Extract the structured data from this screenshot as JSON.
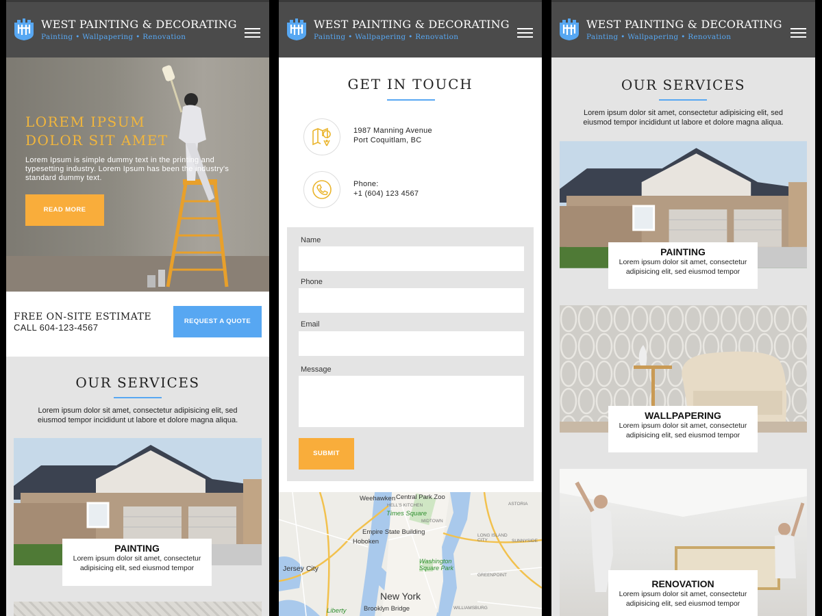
{
  "brand": {
    "name": "WEST PAINTING & DECORATING",
    "tagline": "Painting • Wallpapering • Renovation"
  },
  "colors": {
    "accent_blue": "#57a7f2",
    "accent_orange": "#f9ad3b",
    "header": "#4b4b4b"
  },
  "screen1": {
    "hero": {
      "title_line1": "LOREM IPSUM",
      "title_line2": "DOLOR SIT AMET",
      "text": "Lorem Ipsum is simple dummy text in the printing and typesetting industry. Lorem Ipsum has been the industry's standard dummy text.",
      "button": "READ MORE"
    },
    "estimate": {
      "title": "FREE ON-SITE ESTIMATE",
      "phone": "CALL 604-123-4567",
      "button": "REQUEST A QUOTE"
    },
    "services": {
      "title": "OUR SERVICES",
      "intro": "Lorem ipsum dolor sit amet, consectetur adipisicing elit, sed eiusmod tempor incididunt ut labore et dolore magna aliqua.",
      "card1_title": "PAINTING",
      "card1_text": "Lorem ipsum dolor sit amet, consectetur adipisicing elit, sed eiusmod tempor"
    }
  },
  "screen2": {
    "title": "GET IN TOUCH",
    "address_line1": "1987 Manning Avenue",
    "address_line2": "Port Coquitlam, BC",
    "phone_label": "Phone:",
    "phone_value": "+1 (604) 123 4567",
    "form": {
      "name": "Name",
      "phone": "Phone",
      "email": "Email",
      "message": "Message",
      "submit": "SUBMIT"
    },
    "map_labels": {
      "weehawken": "Weehawken",
      "cpz": "Central Park Zoo",
      "hk": "HELL'S KITCHEN",
      "ts": "Times Square",
      "midtown": "MIDTOWN",
      "astoria": "ASTORIA",
      "esb": "Empire State Building",
      "hoboken": "Hoboken",
      "lic": "LONG ISLAND CITY",
      "sunnyside": "SUNNYSIDE",
      "jc": "Jersey City",
      "wsp": "Washington Square Park",
      "greenpoint": "GREENPOINT",
      "ny": "New York",
      "bb": "Brooklyn Bridge",
      "liberty": "Liberty",
      "williamsburg": "WILLIAMSBURG"
    }
  },
  "screen3": {
    "title": "OUR SERVICES",
    "intro": "Lorem ipsum dolor sit amet, consectetur adipisicing elit, sed eiusmod tempor incididunt ut labore et dolore magna aliqua.",
    "cards": [
      {
        "title": "PAINTING",
        "text": "Lorem ipsum dolor sit amet, consectetur adipisicing elit, sed eiusmod tempor"
      },
      {
        "title": "WALLPAPERING",
        "text": "Lorem ipsum dolor sit amet, consectetur adipisicing elit, sed eiusmod tempor"
      },
      {
        "title": "RENOVATION",
        "text": "Lorem ipsum dolor sit amet, consectetur adipisicing elit, sed eiusmod tempor"
      }
    ]
  },
  "icons": [
    "logo-icon",
    "menu-icon",
    "map-icon",
    "phone-icon"
  ]
}
